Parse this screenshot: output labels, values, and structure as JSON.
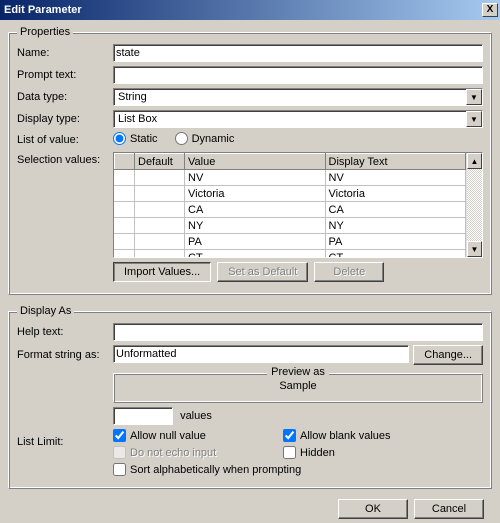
{
  "window": {
    "title": "Edit Parameter",
    "close_label": "X"
  },
  "groups": {
    "properties": "Properties",
    "display_as": "Display As",
    "preview_as": "Preview as"
  },
  "labels": {
    "name": "Name:",
    "prompt_text": "Prompt text:",
    "data_type": "Data type:",
    "display_type": "Display type:",
    "list_of_value": "List of value:",
    "selection_values": "Selection values:",
    "help_text": "Help text:",
    "format_string_as": "Format string as:",
    "list_limit": "List Limit:",
    "values_suffix": "values"
  },
  "fields": {
    "name": "state",
    "prompt_text": "",
    "data_type": "String",
    "display_type": "List Box",
    "help_text": "",
    "format_string_as": "Unformatted",
    "list_limit": "",
    "preview_sample": "Sample"
  },
  "radios": {
    "static": "Static",
    "dynamic": "Dynamic",
    "list_mode": "static"
  },
  "table": {
    "headers": {
      "default": "Default",
      "value": "Value",
      "display_text": "Display Text"
    },
    "rows": [
      {
        "value": "NV",
        "display": "NV"
      },
      {
        "value": "Victoria",
        "display": "Victoria"
      },
      {
        "value": "CA",
        "display": "CA"
      },
      {
        "value": "NY",
        "display": "NY"
      },
      {
        "value": "PA",
        "display": "PA"
      },
      {
        "value": "CT",
        "display": "CT"
      }
    ]
  },
  "buttons": {
    "import_values": "Import Values...",
    "set_as_default": "Set as Default",
    "delete": "Delete",
    "change": "Change...",
    "ok": "OK",
    "cancel": "Cancel"
  },
  "checks": {
    "allow_null": {
      "label": "Allow null value",
      "checked": true
    },
    "allow_blank": {
      "label": "Allow blank values",
      "checked": true
    },
    "do_not_echo": {
      "label": "Do not echo input",
      "checked": false,
      "disabled": true
    },
    "hidden": {
      "label": "Hidden",
      "checked": false
    },
    "sort_alpha": {
      "label": "Sort alphabetically when prompting",
      "checked": false
    }
  }
}
